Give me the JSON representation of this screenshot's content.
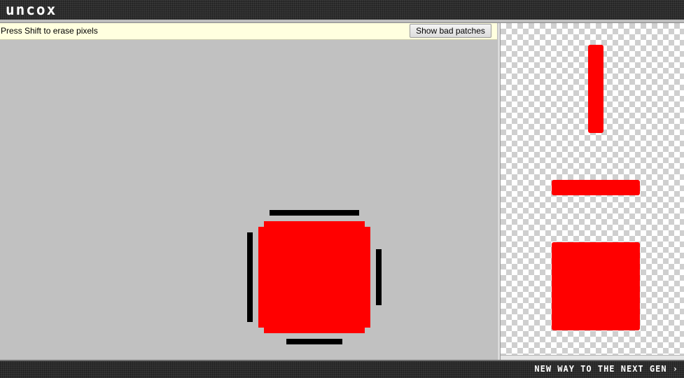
{
  "header": {
    "logo_text": "uncox"
  },
  "editor": {
    "hint_text": "Press Shift to erase pixels",
    "show_bad_patches_label": "Show bad patches"
  },
  "footer": {
    "tagline": "NEW WAY TO THE NEXT GEN ›"
  },
  "colors": {
    "patch_fill": "#ff0000",
    "guide": "#000000",
    "canvas_bg": "#c1c1c1",
    "infobar_bg": "#ffffdf"
  }
}
